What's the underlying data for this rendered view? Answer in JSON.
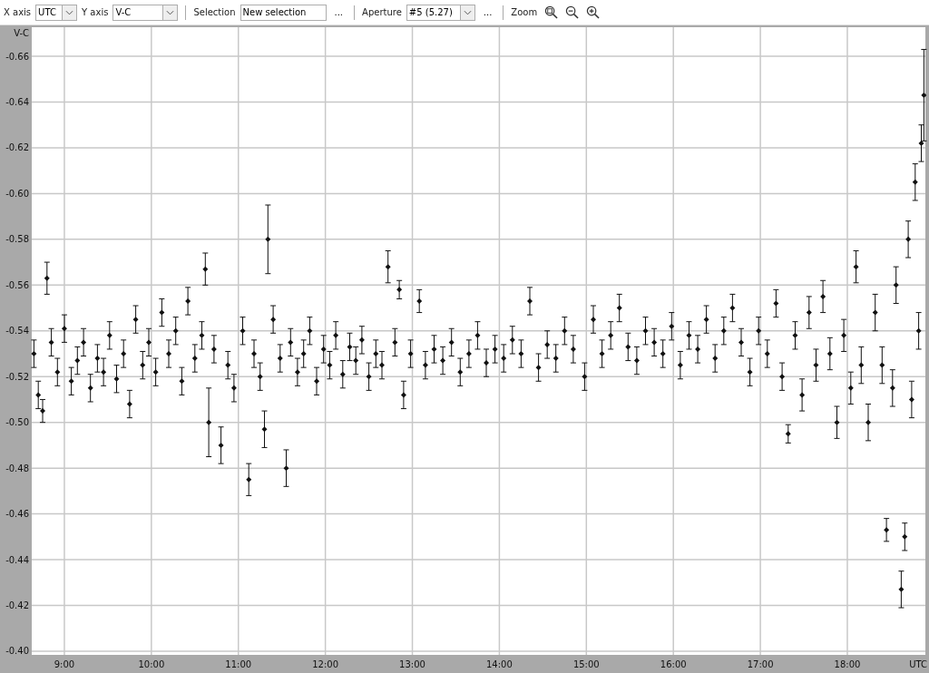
{
  "toolbar": {
    "x_axis": {
      "label": "X axis",
      "value": "UTC"
    },
    "y_axis": {
      "label": "Y axis",
      "value": "V-C"
    },
    "selection": {
      "label": "Selection",
      "value": "New selection",
      "more": "..."
    },
    "aperture": {
      "label": "Aperture",
      "value": "#5 (5.27)",
      "more": "..."
    },
    "zoom": {
      "label": "Zoom"
    }
  },
  "chart": {
    "chart_data": {
      "type": "scatter",
      "grid": true,
      "xlabel": "UTC",
      "ylabel": "V-C",
      "xlim": [
        8.625,
        18.897
      ],
      "ylim": [
        -0.3984,
        -0.6727
      ],
      "xticks": [
        {
          "value": 9,
          "label": "9:00"
        },
        {
          "value": 10,
          "label": "10:00"
        },
        {
          "value": 11,
          "label": "11:00"
        },
        {
          "value": 12,
          "label": "12:00"
        },
        {
          "value": 13,
          "label": "13:00"
        },
        {
          "value": 14,
          "label": "14:00"
        },
        {
          "value": 15,
          "label": "15:00"
        },
        {
          "value": 16,
          "label": "16:00"
        },
        {
          "value": 17,
          "label": "17:00"
        },
        {
          "value": 18,
          "label": "18:00"
        }
      ],
      "yticks": [
        {
          "value": -0.66,
          "label": "-0.66"
        },
        {
          "value": -0.64,
          "label": "-0.64"
        },
        {
          "value": -0.62,
          "label": "-0.62"
        },
        {
          "value": -0.6,
          "label": "-0.60"
        },
        {
          "value": -0.58,
          "label": "-0.58"
        },
        {
          "value": -0.56,
          "label": "-0.56"
        },
        {
          "value": -0.54,
          "label": "-0.54"
        },
        {
          "value": -0.52,
          "label": "-0.52"
        },
        {
          "value": -0.5,
          "label": "-0.50"
        },
        {
          "value": -0.48,
          "label": "-0.48"
        },
        {
          "value": -0.46,
          "label": "-0.46"
        },
        {
          "value": -0.44,
          "label": "-0.44"
        },
        {
          "value": -0.42,
          "label": "-0.42"
        },
        {
          "value": -0.4,
          "label": "-0.40"
        }
      ],
      "x": [
        8.65,
        8.7,
        8.75,
        8.8,
        8.85,
        8.92,
        9,
        9.08,
        9.15,
        9.22,
        9.3,
        9.38,
        9.45,
        9.52,
        9.6,
        9.68,
        9.75,
        9.82,
        9.9,
        9.97,
        10.05,
        10.12,
        10.2,
        10.28,
        10.35,
        10.42,
        10.5,
        10.58,
        10.62,
        10.66,
        10.72,
        10.8,
        10.88,
        10.95,
        11.05,
        11.12,
        11.18,
        11.25,
        11.3,
        11.34,
        11.4,
        11.48,
        11.55,
        11.6,
        11.68,
        11.75,
        11.82,
        11.9,
        11.98,
        12.05,
        12.12,
        12.2,
        12.28,
        12.35,
        12.42,
        12.5,
        12.58,
        12.65,
        12.72,
        12.8,
        12.85,
        12.9,
        12.98,
        13.08,
        13.15,
        13.25,
        13.35,
        13.45,
        13.55,
        13.65,
        13.75,
        13.85,
        13.95,
        14.05,
        14.15,
        14.25,
        14.35,
        14.45,
        14.55,
        14.65,
        14.75,
        14.85,
        14.98,
        15.08,
        15.18,
        15.28,
        15.38,
        15.48,
        15.58,
        15.68,
        15.78,
        15.88,
        15.98,
        16.08,
        16.18,
        16.28,
        16.38,
        16.48,
        16.58,
        16.68,
        16.78,
        16.88,
        16.98,
        17.08,
        17.18,
        17.25,
        17.32,
        17.4,
        17.48,
        17.56,
        17.64,
        17.72,
        17.8,
        17.88,
        17.96,
        18.04,
        18.1,
        18.16,
        18.24,
        18.32,
        18.4,
        18.45,
        18.52,
        18.56,
        18.62,
        18.66,
        18.7,
        18.74,
        18.78,
        18.82,
        18.85,
        18.88
      ],
      "series": [
        {
          "color": "#111111",
          "values": [
            -0.53,
            -0.512,
            -0.505,
            -0.563,
            -0.535,
            -0.522,
            -0.541,
            -0.518,
            -0.527,
            -0.535,
            -0.515,
            -0.528,
            -0.522,
            -0.538,
            -0.519,
            -0.53,
            -0.508,
            -0.545,
            -0.525,
            -0.535,
            -0.522,
            -0.548,
            -0.53,
            -0.54,
            -0.518,
            -0.553,
            -0.528,
            -0.538,
            -0.567,
            -0.5,
            -0.532,
            -0.49,
            -0.525,
            -0.515,
            -0.54,
            -0.475,
            -0.53,
            -0.52,
            -0.497,
            -0.58,
            -0.545,
            -0.528,
            -0.48,
            -0.535,
            -0.522,
            -0.53,
            -0.54,
            -0.518,
            -0.532,
            -0.525,
            -0.538,
            -0.521,
            -0.533,
            -0.527,
            -0.536,
            -0.52,
            -0.53,
            -0.525,
            -0.568,
            -0.535,
            -0.558,
            -0.512,
            -0.53,
            -0.553,
            -0.525,
            -0.532,
            -0.527,
            -0.535,
            -0.522,
            -0.53,
            -0.538,
            -0.526,
            -0.532,
            -0.528,
            -0.536,
            -0.53,
            -0.553,
            -0.524,
            -0.534,
            -0.528,
            -0.54,
            -0.532,
            -0.52,
            -0.545,
            -0.53,
            -0.538,
            -0.55,
            -0.533,
            -0.527,
            -0.54,
            -0.535,
            -0.53,
            -0.542,
            -0.525,
            -0.538,
            -0.532,
            -0.545,
            -0.528,
            -0.54,
            -0.55,
            -0.535,
            -0.522,
            -0.54,
            -0.53,
            -0.552,
            -0.52,
            -0.495,
            -0.538,
            -0.512,
            -0.548,
            -0.525,
            -0.555,
            -0.53,
            -0.5,
            -0.538,
            -0.515,
            -0.568,
            -0.525,
            -0.5,
            -0.548,
            -0.525,
            -0.453,
            -0.515,
            -0.56,
            -0.427,
            -0.45,
            -0.58,
            -0.51,
            -0.605,
            -0.54,
            -0.622,
            -0.643
          ],
          "errors": [
            0.006,
            0.006,
            0.005,
            0.007,
            0.006,
            0.006,
            0.006,
            0.006,
            0.006,
            0.006,
            0.006,
            0.006,
            0.006,
            0.006,
            0.006,
            0.006,
            0.006,
            0.006,
            0.006,
            0.006,
            0.006,
            0.006,
            0.006,
            0.006,
            0.006,
            0.006,
            0.006,
            0.006,
            0.007,
            0.015,
            0.006,
            0.008,
            0.006,
            0.006,
            0.006,
            0.007,
            0.006,
            0.006,
            0.008,
            0.015,
            0.006,
            0.006,
            0.008,
            0.006,
            0.006,
            0.006,
            0.006,
            0.006,
            0.006,
            0.006,
            0.006,
            0.006,
            0.006,
            0.006,
            0.006,
            0.006,
            0.006,
            0.006,
            0.007,
            0.006,
            0.004,
            0.006,
            0.006,
            0.005,
            0.006,
            0.006,
            0.006,
            0.006,
            0.006,
            0.006,
            0.006,
            0.006,
            0.006,
            0.006,
            0.006,
            0.006,
            0.006,
            0.006,
            0.006,
            0.006,
            0.006,
            0.006,
            0.006,
            0.006,
            0.006,
            0.006,
            0.006,
            0.006,
            0.006,
            0.006,
            0.006,
            0.006,
            0.006,
            0.006,
            0.006,
            0.006,
            0.006,
            0.006,
            0.006,
            0.006,
            0.006,
            0.006,
            0.006,
            0.006,
            0.006,
            0.006,
            0.004,
            0.006,
            0.007,
            0.007,
            0.007,
            0.007,
            0.007,
            0.007,
            0.007,
            0.007,
            0.007,
            0.008,
            0.008,
            0.008,
            0.008,
            0.005,
            0.008,
            0.008,
            0.008,
            0.006,
            0.008,
            0.008,
            0.008,
            0.008,
            0.008,
            0.02
          ]
        }
      ]
    }
  }
}
